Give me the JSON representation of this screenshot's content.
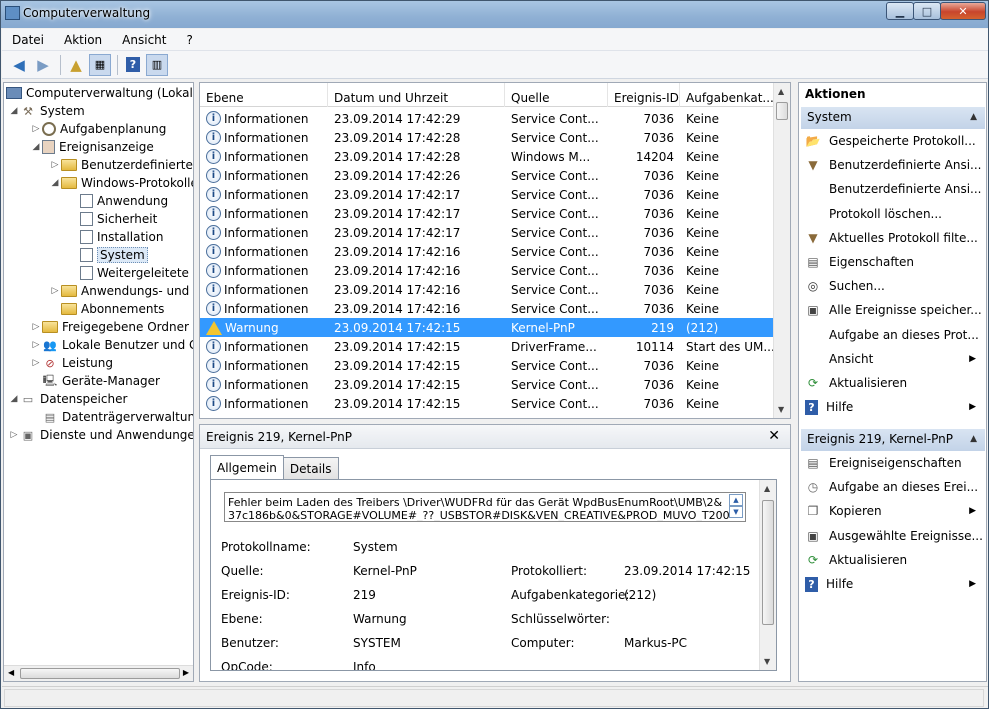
{
  "window": {
    "title": "Computerverwaltung"
  },
  "menu": [
    "Datei",
    "Aktion",
    "Ansicht",
    "?"
  ],
  "tree": {
    "items": [
      {
        "label": "Computerverwaltung (Lokal)",
        "level": 0,
        "icon": "computer-icon"
      },
      {
        "label": "System",
        "level": 1,
        "icon": "tools-icon"
      },
      {
        "label": "Aufgabenplanung",
        "level": 2,
        "icon": "clock-icon"
      },
      {
        "label": "Ereignisanzeige",
        "level": 2,
        "icon": "event-viewer-icon"
      },
      {
        "label": "Benutzerdefinierte Ansichten",
        "level": 3,
        "icon": "folder-icon"
      },
      {
        "label": "Windows-Protokolle",
        "level": 3,
        "icon": "folder-icon"
      },
      {
        "label": "Anwendung",
        "level": 4,
        "icon": "log-icon"
      },
      {
        "label": "Sicherheit",
        "level": 4,
        "icon": "log-icon"
      },
      {
        "label": "Installation",
        "level": 4,
        "icon": "log-icon"
      },
      {
        "label": "System",
        "level": 4,
        "icon": "log-icon"
      },
      {
        "label": "Weitergeleitete Ereignisse",
        "level": 4,
        "icon": "log-icon"
      },
      {
        "label": "Anwendungs- und Dienstprotokolle",
        "level": 3,
        "icon": "folder-icon"
      },
      {
        "label": "Abonnements",
        "level": 3,
        "icon": "folder-icon"
      },
      {
        "label": "Freigegebene Ordner",
        "level": 2,
        "icon": "shared-folder-icon"
      },
      {
        "label": "Lokale Benutzer und Gruppen",
        "level": 2,
        "icon": "users-icon"
      },
      {
        "label": "Leistung",
        "level": 2,
        "icon": "performance-icon"
      },
      {
        "label": "Geräte-Manager",
        "level": 2,
        "icon": "device-manager-icon"
      },
      {
        "label": "Datenspeicher",
        "level": 1,
        "icon": "storage-icon"
      },
      {
        "label": "Datenträgerverwaltung",
        "level": 2,
        "icon": "disk-icon"
      },
      {
        "label": "Dienste und Anwendungen",
        "level": 1,
        "icon": "services-icon"
      }
    ]
  },
  "events": {
    "columns": [
      "Ebene",
      "Datum und Uhrzeit",
      "Quelle",
      "Ereignis-ID",
      "Aufgabenkat..."
    ],
    "rows": [
      [
        "Informationen",
        "23.09.2014 17:42:29",
        "Service Cont...",
        "7036",
        "Keine",
        "info"
      ],
      [
        "Informationen",
        "23.09.2014 17:42:28",
        "Service Cont...",
        "7036",
        "Keine",
        "info"
      ],
      [
        "Informationen",
        "23.09.2014 17:42:28",
        "Windows M...",
        "14204",
        "Keine",
        "info"
      ],
      [
        "Informationen",
        "23.09.2014 17:42:26",
        "Service Cont...",
        "7036",
        "Keine",
        "info"
      ],
      [
        "Informationen",
        "23.09.2014 17:42:17",
        "Service Cont...",
        "7036",
        "Keine",
        "info"
      ],
      [
        "Informationen",
        "23.09.2014 17:42:17",
        "Service Cont...",
        "7036",
        "Keine",
        "info"
      ],
      [
        "Informationen",
        "23.09.2014 17:42:17",
        "Service Cont...",
        "7036",
        "Keine",
        "info"
      ],
      [
        "Informationen",
        "23.09.2014 17:42:16",
        "Service Cont...",
        "7036",
        "Keine",
        "info"
      ],
      [
        "Informationen",
        "23.09.2014 17:42:16",
        "Service Cont...",
        "7036",
        "Keine",
        "info"
      ],
      [
        "Informationen",
        "23.09.2014 17:42:16",
        "Service Cont...",
        "7036",
        "Keine",
        "info"
      ],
      [
        "Informationen",
        "23.09.2014 17:42:16",
        "Service Cont...",
        "7036",
        "Keine",
        "info"
      ],
      [
        "Warnung",
        "23.09.2014 17:42:15",
        "Kernel-PnP",
        "219",
        "(212)",
        "warn"
      ],
      [
        "Informationen",
        "23.09.2014 17:42:15",
        "DriverFrame...",
        "10114",
        "Start des UM...",
        "info"
      ],
      [
        "Informationen",
        "23.09.2014 17:42:15",
        "Service Cont...",
        "7036",
        "Keine",
        "info"
      ],
      [
        "Informationen",
        "23.09.2014 17:42:15",
        "Service Cont...",
        "7036",
        "Keine",
        "info"
      ],
      [
        "Informationen",
        "23.09.2014 17:42:15",
        "Service Cont...",
        "7036",
        "Keine",
        "info"
      ]
    ]
  },
  "detail": {
    "title": "Ereignis 219, Kernel-PnP",
    "tabs": [
      "Allgemein",
      "Details"
    ],
    "message_line1": "Fehler beim Laden des Treibers \\Driver\\WUDFRd für das Gerät WpdBusEnumRoot\\UMB\\2&",
    "message_line2": "37c186b&0&STORAGE#VOLUME#_??_USBSTOR#DISK&VEN_CREATIVE&PROD_MUVO_T200",
    "labels": {
      "protokollname": "Protokollname:",
      "quelle": "Quelle:",
      "ereignis_id": "Ereignis-ID:",
      "ebene": "Ebene:",
      "benutzer": "Benutzer:",
      "opcode": "OpCode:",
      "protokolliert": "Protokolliert:",
      "aufgabenkategorie": "Aufgabenkategorie:",
      "schluesselwoerter": "Schlüsselwörter:",
      "computer": "Computer:"
    },
    "values": {
      "protokollname": "System",
      "quelle": "Kernel-PnP",
      "ereignis_id": "219",
      "ebene": "Warnung",
      "benutzer": "SYSTEM",
      "opcode": "Info",
      "protokolliert": "23.09.2014 17:42:15",
      "aufgabenkategorie": "(212)",
      "schluesselwoerter": "",
      "computer": "Markus-PC"
    }
  },
  "actions": {
    "header": "Aktionen",
    "section1": "System",
    "items1": [
      {
        "label": "Gespeicherte Protokoll...",
        "icon": "open-folder-icon"
      },
      {
        "label": "Benutzerdefinierte Ansi...",
        "icon": "filter-icon"
      },
      {
        "label": "Benutzerdefinierte Ansi...",
        "icon": ""
      },
      {
        "label": "Protokoll löschen...",
        "icon": ""
      },
      {
        "label": "Aktuelles Protokoll filte...",
        "icon": "filter-icon"
      },
      {
        "label": "Eigenschaften",
        "icon": "properties-icon"
      },
      {
        "label": "Suchen...",
        "icon": "binoculars-icon"
      },
      {
        "label": "Alle Ereignisse speicher...",
        "icon": "save-icon"
      },
      {
        "label": "Aufgabe an dieses Prot...",
        "icon": ""
      },
      {
        "label": "Ansicht",
        "icon": "",
        "submenu": true
      },
      {
        "label": "Aktualisieren",
        "icon": "refresh-icon"
      },
      {
        "label": "Hilfe",
        "icon": "help-icon",
        "submenu": true
      }
    ],
    "section2": "Ereignis 219, Kernel-PnP",
    "items2": [
      {
        "label": "Ereigniseigenschaften",
        "icon": "properties-icon"
      },
      {
        "label": "Aufgabe an dieses Erei...",
        "icon": "task-icon"
      },
      {
        "label": "Kopieren",
        "icon": "copy-icon",
        "submenu": true
      },
      {
        "label": "Ausgewählte Ereignisse...",
        "icon": "save-icon"
      },
      {
        "label": "Aktualisieren",
        "icon": "refresh-icon"
      },
      {
        "label": "Hilfe",
        "icon": "help-icon",
        "submenu": true
      }
    ]
  }
}
